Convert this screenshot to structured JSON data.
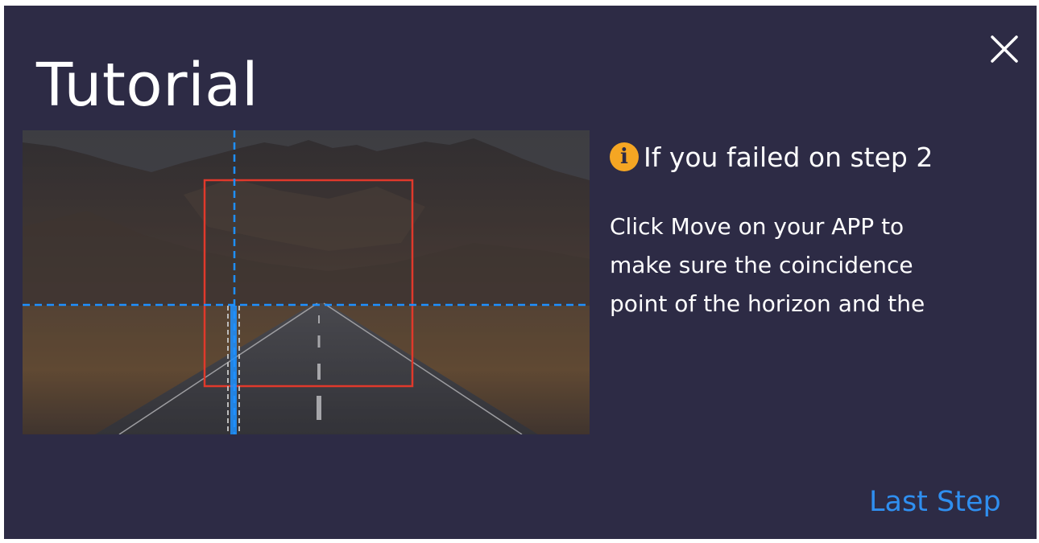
{
  "dialog": {
    "title": "Tutorial",
    "close_icon": "close-icon",
    "info_icon": "info-icon",
    "info_icon_glyph": "i",
    "heading": "If you failed on step 2",
    "body_lines": [
      "Click Move on your APP to",
      "make sure the coincidence",
      "point of the horizon and the"
    ],
    "last_step_label": "Last Step"
  },
  "colors": {
    "panel_background": "#2d2b45",
    "text": "#ffffff",
    "accent_link": "#2f8ff0",
    "info_icon": "#f5a623",
    "guide_line_blue": "#1e90ff",
    "frame_red": "#e0392b"
  }
}
